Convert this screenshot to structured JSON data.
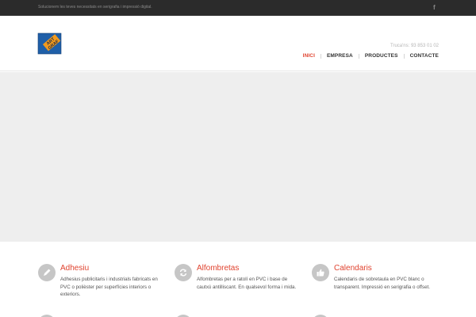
{
  "topbar": {
    "tagline": "Solucionem les teves necessitats en serigrafia i impressió digital.",
    "social_icon": "facebook-icon"
  },
  "header": {
    "logo_lines": [
      "ART",
      "GRAF"
    ],
    "phone": "Truca'ns: 93 853 01 02",
    "nav": [
      {
        "label": "INICI",
        "active": true
      },
      {
        "label": "EMPRESA",
        "active": false
      },
      {
        "label": "PRODUCTES",
        "active": false
      },
      {
        "label": "CONTACTE",
        "active": false
      }
    ]
  },
  "services": [
    {
      "title": "Adhesiu",
      "description": "Adhesius publicitaris i industrials fabricats en PVC o polièster per superfícies interiors o exteriors.",
      "icon": "pencil-icon"
    },
    {
      "title": "Alfombretas",
      "description": "Alfombretas per a ratolí en PVC i base de cautxú antilliscant. En qualsevol forma i mida.",
      "icon": "refresh-icon"
    },
    {
      "title": "Calendaris",
      "description": "Calendaris de sobretaula en PVC blanc o transparent. Impressió en serigrafia o offset.",
      "icon": "thumbs-up-icon"
    }
  ],
  "colors": {
    "accent": "#e0432f",
    "topbar": "#2b2b2b",
    "slider_bg": "#eeeeee",
    "icon_circle": "#c6c6c6",
    "logo_blue": "#1f5fa8",
    "logo_orange": "#f29a1d"
  }
}
